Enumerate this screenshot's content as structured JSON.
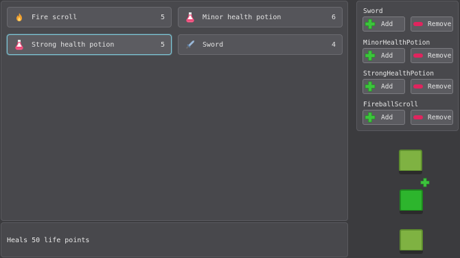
{
  "inventory": {
    "items": [
      {
        "name": "Fire scroll",
        "count": "5",
        "icon": "fire-icon"
      },
      {
        "name": "Minor health potion",
        "count": "6",
        "icon": "potion-icon"
      },
      {
        "name": "Strong health potion",
        "count": "5",
        "icon": "potion-icon",
        "selected": true
      },
      {
        "name": "Sword",
        "count": "4",
        "icon": "sword-icon"
      }
    ]
  },
  "description": {
    "text": "Heals 50 life points"
  },
  "controls": {
    "groups": [
      {
        "label": "Sword",
        "add": "Add",
        "remove": "Remove"
      },
      {
        "label": "MinorHealthPotion",
        "add": "Add",
        "remove": "Remove"
      },
      {
        "label": "StrongHealthPotion",
        "add": "Add",
        "remove": "Remove"
      },
      {
        "label": "FireballScroll",
        "add": "Add",
        "remove": "Remove"
      }
    ]
  },
  "colors": {
    "selected_border": "#7ec6d6",
    "add_green": "#3cc43c",
    "remove_red": "#e0245e",
    "slot_green": "#7fb242",
    "slot_active": "#2db52d"
  }
}
